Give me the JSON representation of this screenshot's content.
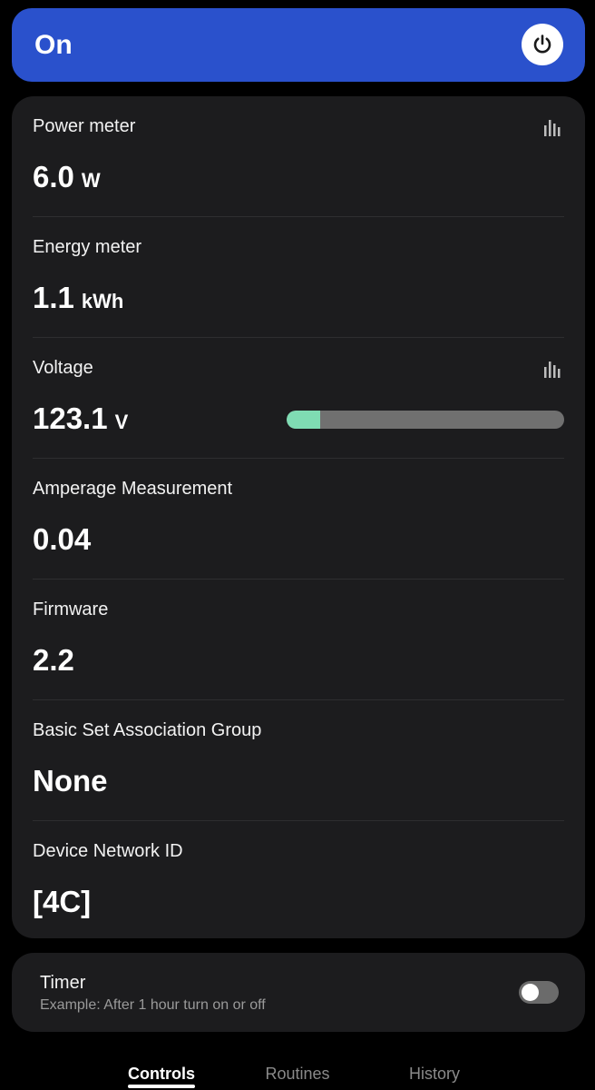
{
  "header": {
    "state_label": "On"
  },
  "metrics": [
    {
      "label": "Power meter",
      "value": "6.0",
      "unit": "W",
      "has_chart": true
    },
    {
      "label": "Energy meter",
      "value": "1.1",
      "unit": "kWh",
      "has_chart": false
    },
    {
      "label": "Voltage",
      "value": "123.1",
      "unit": "V",
      "has_chart": true,
      "level_fraction": 0.12
    },
    {
      "label": "Amperage Measurement",
      "value": "0.04",
      "unit": "",
      "has_chart": false
    },
    {
      "label": "Firmware",
      "value": "2.2",
      "unit": "",
      "has_chart": false
    },
    {
      "label": "Basic Set Association Group",
      "value": "None",
      "unit": "",
      "has_chart": false
    },
    {
      "label": "Device Network ID",
      "value": "[4C]",
      "unit": "",
      "has_chart": false
    }
  ],
  "timer": {
    "title": "Timer",
    "subtitle": "Example: After 1 hour turn on or off",
    "enabled": false
  },
  "tabs": [
    {
      "label": "Controls",
      "active": true
    },
    {
      "label": "Routines",
      "active": false
    },
    {
      "label": "History",
      "active": false
    }
  ],
  "colors": {
    "accent": "#2a51cc",
    "voltage_fill": "#7fdcb3",
    "card_bg": "#1c1c1e"
  },
  "icons": {
    "power": "power-icon",
    "chart": "bar-chart-icon"
  }
}
